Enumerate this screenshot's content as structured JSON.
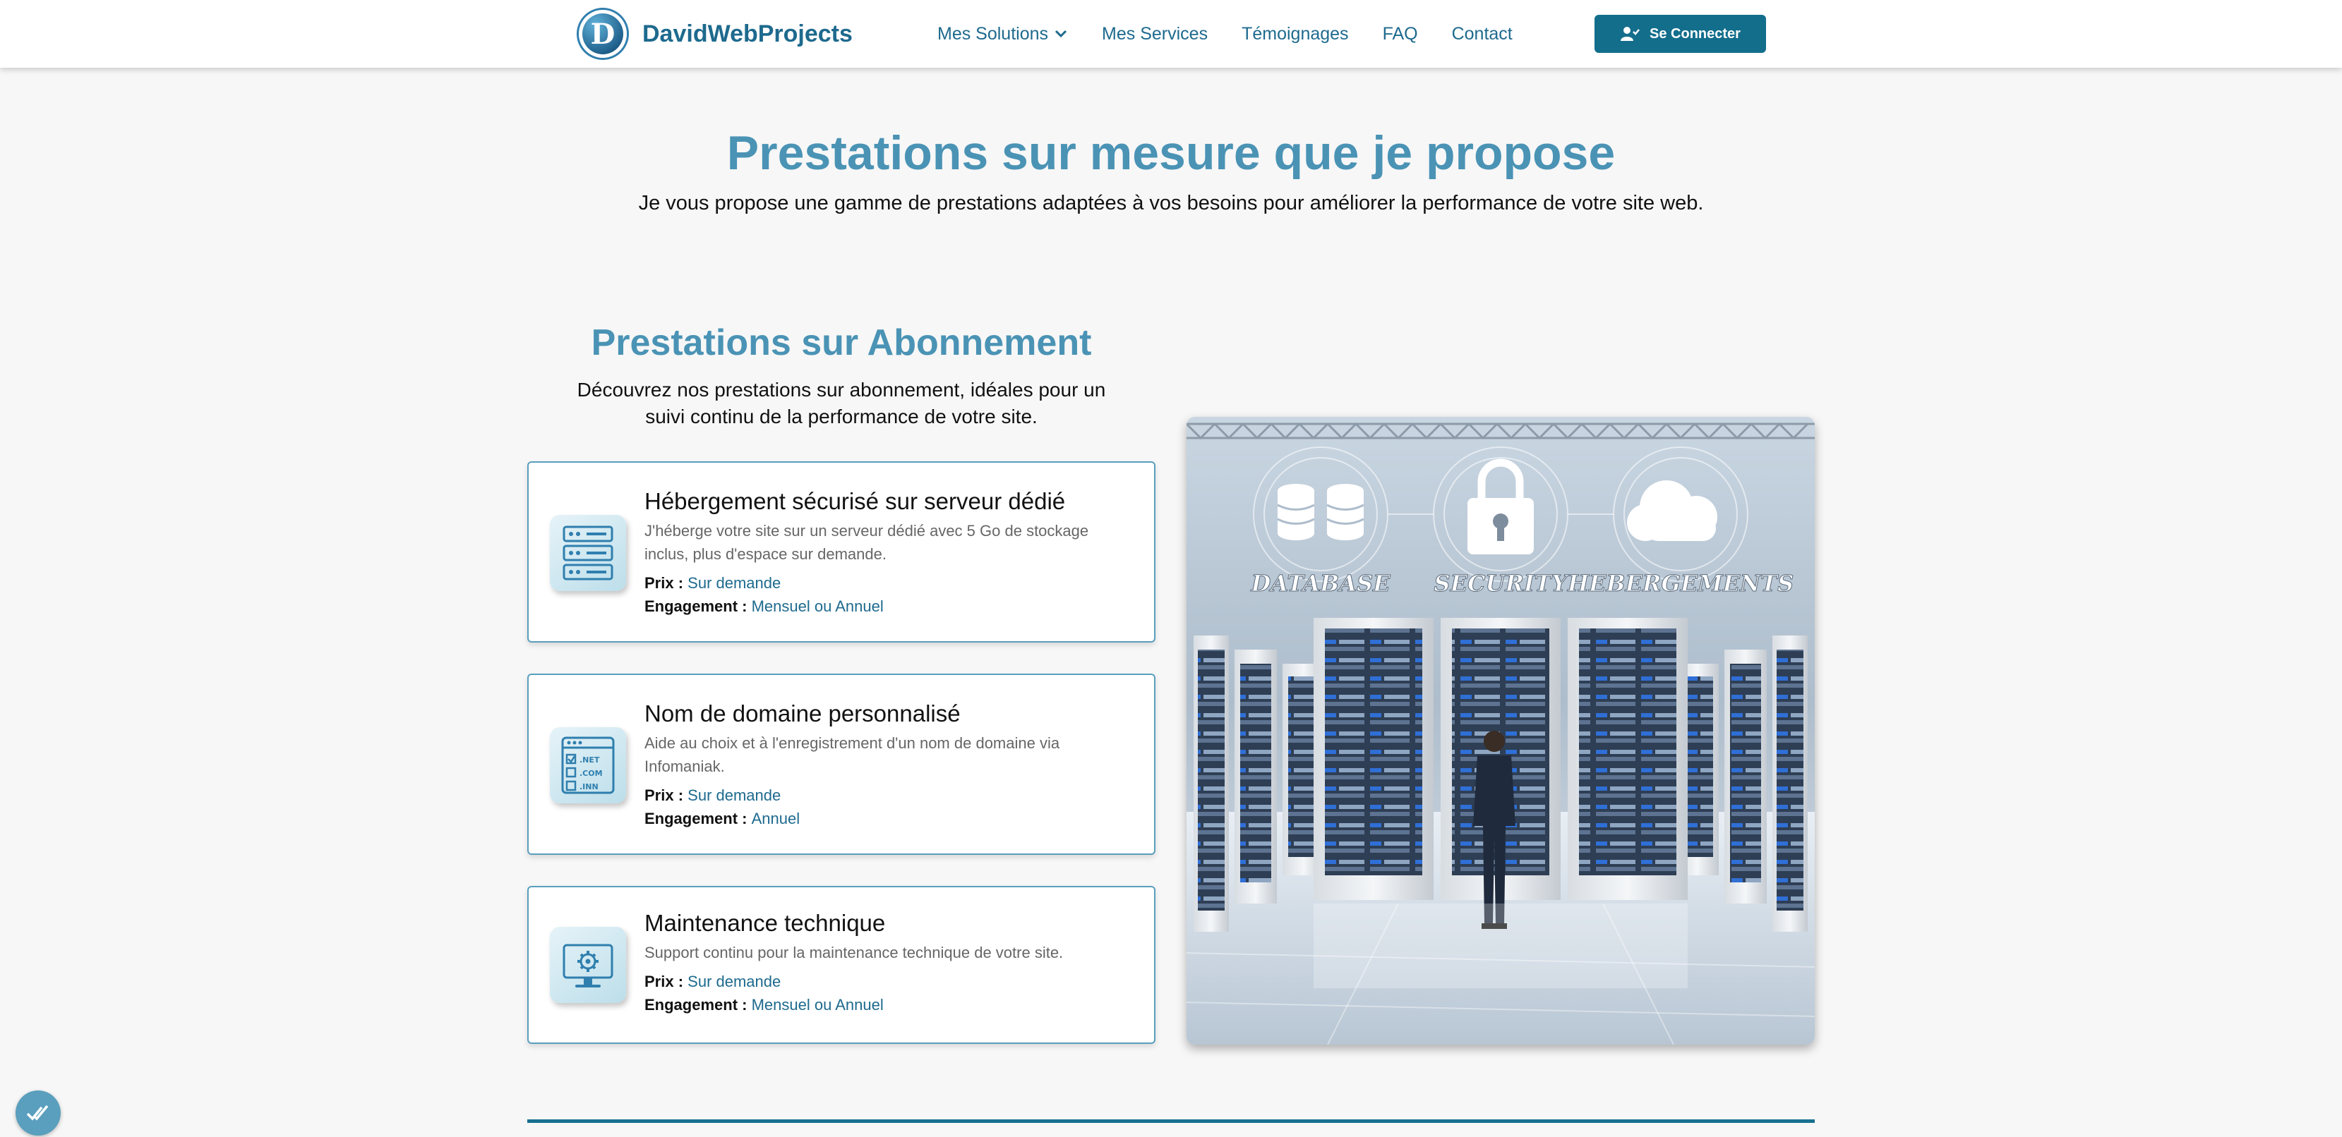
{
  "navbar": {
    "brand_letter": "D",
    "brand_name": "DavidWebProjects",
    "links": [
      {
        "label": "Mes Solutions",
        "icon": "chevron-down-icon"
      },
      {
        "label": "Mes Services"
      },
      {
        "label": "Témoignages"
      },
      {
        "label": "FAQ"
      },
      {
        "label": "Contact"
      }
    ],
    "login_label": "Se Connecter",
    "login_icon": "user-check-icon"
  },
  "hero": {
    "title": "Prestations sur mesure que je propose",
    "subtitle": "Je vous propose une gamme de prestations adaptées à vos besoins pour améliorer la performance de votre site web."
  },
  "section": {
    "title": "Prestations sur Abonnement",
    "subtitle": "Découvrez nos prestations sur abonnement, idéales pour un suivi continu de la performance de votre site.",
    "price_label": "Prix :",
    "engagement_label": "Engagement :",
    "cards": [
      {
        "title": "Hébergement sécurisé sur serveur dédié",
        "description": "J'héberge votre site sur un serveur dédié avec 5 Go de stockage inclus, plus d'espace sur demande.",
        "price": "Sur demande",
        "engagement": "Mensuel ou Annuel",
        "icon": "server-rack-icon"
      },
      {
        "title": "Nom de domaine personnalisé",
        "description": "Aide au choix et à l'enregistrement d'un nom de domaine via Infomaniak.",
        "price": "Sur demande",
        "engagement": "Annuel",
        "icon": "domain-list-icon",
        "icon_labels": [
          ".NET",
          ".COM",
          ".INN"
        ]
      },
      {
        "title": "Maintenance technique",
        "description": "Support continu pour la maintenance technique de votre site.",
        "price": "Sur demande",
        "engagement": "Mensuel ou Annuel",
        "icon": "monitor-gear-icon"
      }
    ]
  },
  "illustration": {
    "labels": [
      "DATABASE",
      "SECURITY",
      "HEBERGEMENTS"
    ],
    "icons": [
      "database-icon",
      "padlock-icon",
      "cloud-icon"
    ]
  },
  "fab_icon": "double-check-icon",
  "colors": {
    "accent": "#4a93b5",
    "nav_text": "#1e6a8e",
    "button_bg": "#136e8c",
    "card_border": "#5a9fbd",
    "page_bg": "#f7f7f7"
  }
}
